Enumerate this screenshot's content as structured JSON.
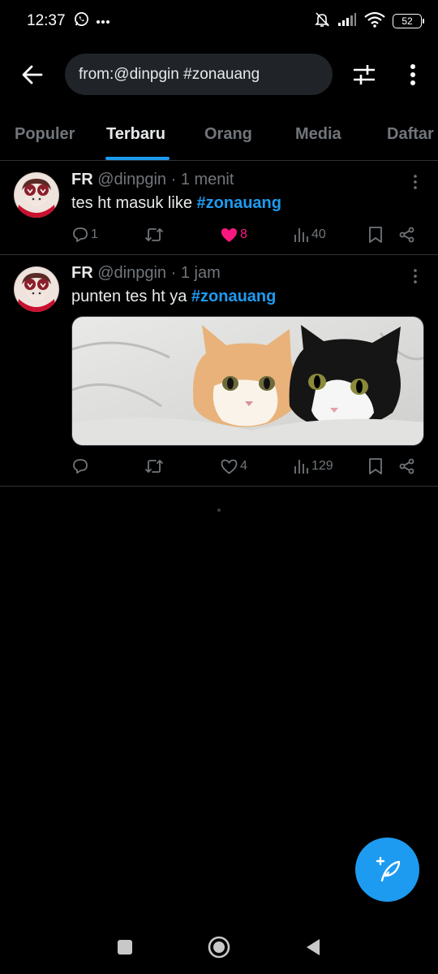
{
  "status_bar": {
    "time": "12:37",
    "battery": "52",
    "icons": [
      "whatsapp-icon",
      "more-dots-icon",
      "bell-muted-icon",
      "signal-icon",
      "wifi-icon",
      "battery-icon"
    ]
  },
  "app_bar": {
    "search_value": "from:@dinpgin #zonauang",
    "icons": [
      "back-arrow-icon",
      "filter-sliders-icon",
      "vertical-more-icon"
    ]
  },
  "tabs": [
    {
      "label": "Populer",
      "active": false
    },
    {
      "label": "Terbaru",
      "active": true
    },
    {
      "label": "Orang",
      "active": false
    },
    {
      "label": "Media",
      "active": false
    },
    {
      "label": "Daftar",
      "active": false
    }
  ],
  "tweets": [
    {
      "name": "FR",
      "handle": "@dinpgin",
      "separator": "·",
      "time": "1 menit",
      "text": "tes ht masuk like ",
      "hashtag": "#zonauang",
      "replies": "1",
      "retweets": "",
      "likes": "8",
      "liked": true,
      "views": "40"
    },
    {
      "name": "FR",
      "handle": "@dinpgin",
      "separator": "·",
      "time": "1 jam",
      "text": "punten tes ht ya ",
      "hashtag": "#zonauang",
      "replies": "",
      "retweets": "",
      "likes": "4",
      "liked": false,
      "views": "129",
      "media": "two-kittens-under-blanket-photo"
    }
  ],
  "colors": {
    "background": "#000000",
    "accent": "#1d9bf0",
    "like": "#f91880",
    "muted_text": "#71767b",
    "primary_text": "#e7e9ea",
    "divider": "#2f3336"
  },
  "fab": {
    "icon": "compose-feather-icon"
  },
  "nav_bar": {
    "icons": [
      "recents-square-icon",
      "home-circle-icon",
      "back-triangle-icon"
    ]
  }
}
